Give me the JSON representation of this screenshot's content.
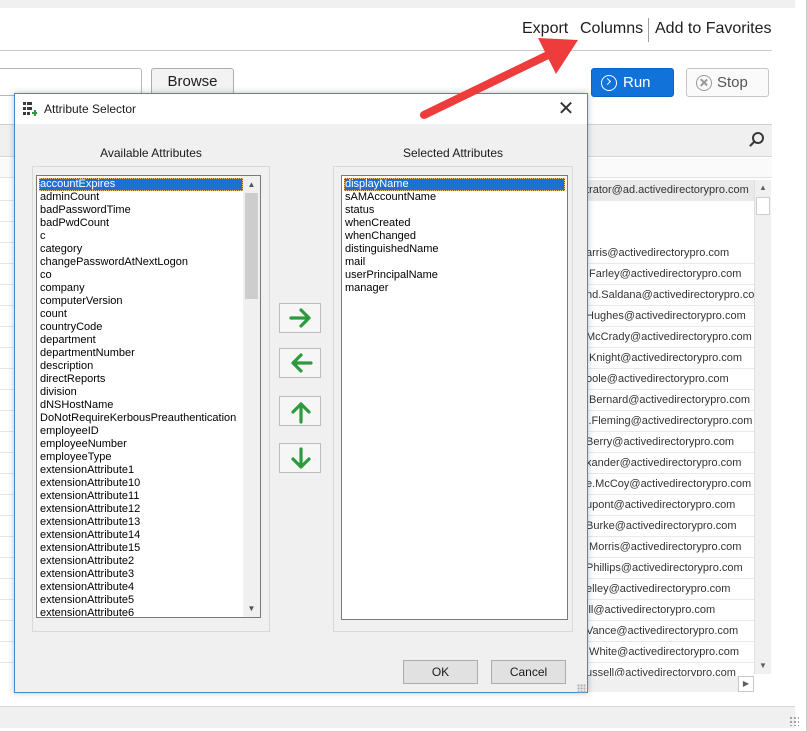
{
  "toolbar": {
    "export_label": "Export",
    "columns_label": "Columns",
    "add_favorites_label": "Add to Favorites",
    "browse_label": "Browse",
    "run_label": "Run",
    "stop_label": "Stop"
  },
  "grid": {
    "first_row_email": "trator@ad.activedirectorypro.com",
    "emails": [
      "arris@activedirectorypro.com",
      ".Farley@activedirectorypro.com",
      "nd.Saldana@activedirectorypro.co",
      "Hughes@activedirectorypro.com",
      "McCrady@activedirectorypro.com",
      ".Knight@activedirectorypro.com",
      "oole@activedirectorypro.com",
      ".Bernard@activedirectorypro.com",
      "l.Fleming@activedirectorypro.com",
      "Berry@activedirectorypro.com",
      "xander@activedirectorypro.com",
      "e.McCoy@activedirectorypro.com",
      "upont@activedirectorypro.com",
      "Burke@activedirectorypro.com",
      ".Morris@activedirectorypro.com",
      "Phillips@activedirectorypro.com",
      "elley@activedirectorypro.com",
      "ill@activedirectorypro.com",
      "Vance@activedirectorypro.com",
      ".White@activedirectorypro.com",
      "ussell@activedirectorypro.com"
    ]
  },
  "dialog": {
    "title": "Attribute Selector",
    "available_label": "Available Attributes",
    "selected_label": "Selected Attributes",
    "available_attributes": [
      "accountExpires",
      "adminCount",
      "badPasswordTime",
      "badPwdCount",
      "c",
      "category",
      "changePasswordAtNextLogon",
      "co",
      "company",
      "computerVersion",
      "count",
      "countryCode",
      "department",
      "departmentNumber",
      "description",
      "directReports",
      "division",
      "dNSHostName",
      "DoNotRequireKerbousPreauthentication",
      "employeeID",
      "employeeNumber",
      "employeeType",
      "extensionAttribute1",
      "extensionAttribute10",
      "extensionAttribute11",
      "extensionAttribute12",
      "extensionAttribute13",
      "extensionAttribute14",
      "extensionAttribute15",
      "extensionAttribute2",
      "extensionAttribute3",
      "extensionAttribute4",
      "extensionAttribute5",
      "extensionAttribute6"
    ],
    "selected_attributes": [
      "displayName",
      "sAMAccountName",
      "status",
      "whenCreated",
      "whenChanged",
      "distinguishedName",
      "mail",
      "userPrincipalName",
      "manager"
    ],
    "ok_label": "OK",
    "cancel_label": "Cancel"
  },
  "colors": {
    "accent": "#1173d9",
    "selection": "#1d6fd3",
    "move_arrows": "#2e9a3e",
    "annotation_arrow": "#ee3b3b"
  },
  "icons": {
    "move_right": "arrow-right-icon",
    "move_left": "arrow-left-icon",
    "move_up": "arrow-up-icon",
    "move_down": "arrow-down-icon"
  }
}
